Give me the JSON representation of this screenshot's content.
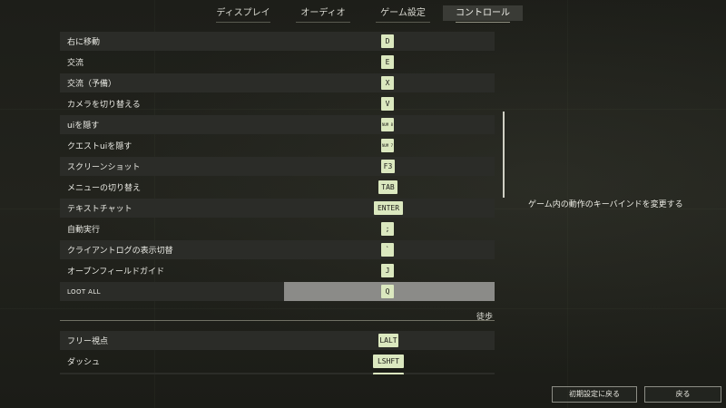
{
  "tabs": [
    {
      "label": "ディスプレイ",
      "active": false
    },
    {
      "label": "オーディオ",
      "active": false
    },
    {
      "label": "ゲーム設定",
      "active": false
    },
    {
      "label": "コントロール",
      "active": true
    }
  ],
  "bindings": [
    {
      "action": "右に移動",
      "key": "D"
    },
    {
      "action": "交流",
      "key": "E"
    },
    {
      "action": "交流（予備）",
      "key": "X"
    },
    {
      "action": "カメラを切り替える",
      "key": "V"
    },
    {
      "action": "uiを隠す",
      "key": "NUM 8"
    },
    {
      "action": "クエストuiを隠す",
      "key": "NUM 7"
    },
    {
      "action": "スクリーンショット",
      "key": "F3"
    },
    {
      "action": "メニューの切り替え",
      "key": "TAB"
    },
    {
      "action": "テキストチャット",
      "key": "ENTER"
    },
    {
      "action": "自動実行",
      "key": ";"
    },
    {
      "action": "クライアントログの表示切替",
      "key": "`"
    },
    {
      "action": "オープンフィールドガイド",
      "key": "J"
    },
    {
      "action": "LOOT ALL",
      "key": "Q"
    }
  ],
  "section": {
    "title": "徒歩"
  },
  "bindings2": [
    {
      "action": "フリー視点",
      "key": "LALT"
    },
    {
      "action": "ダッシュ",
      "key": "LSHFT"
    }
  ],
  "description": "ゲーム内の動作のキーバインドを変更する",
  "buttons": {
    "reset": "初期設定に戻る",
    "back": "戻る"
  },
  "colors": {
    "key_bg": "#dbe8bf",
    "row_shade": "#2b2c28",
    "selected_slot": "#8b8b88"
  }
}
